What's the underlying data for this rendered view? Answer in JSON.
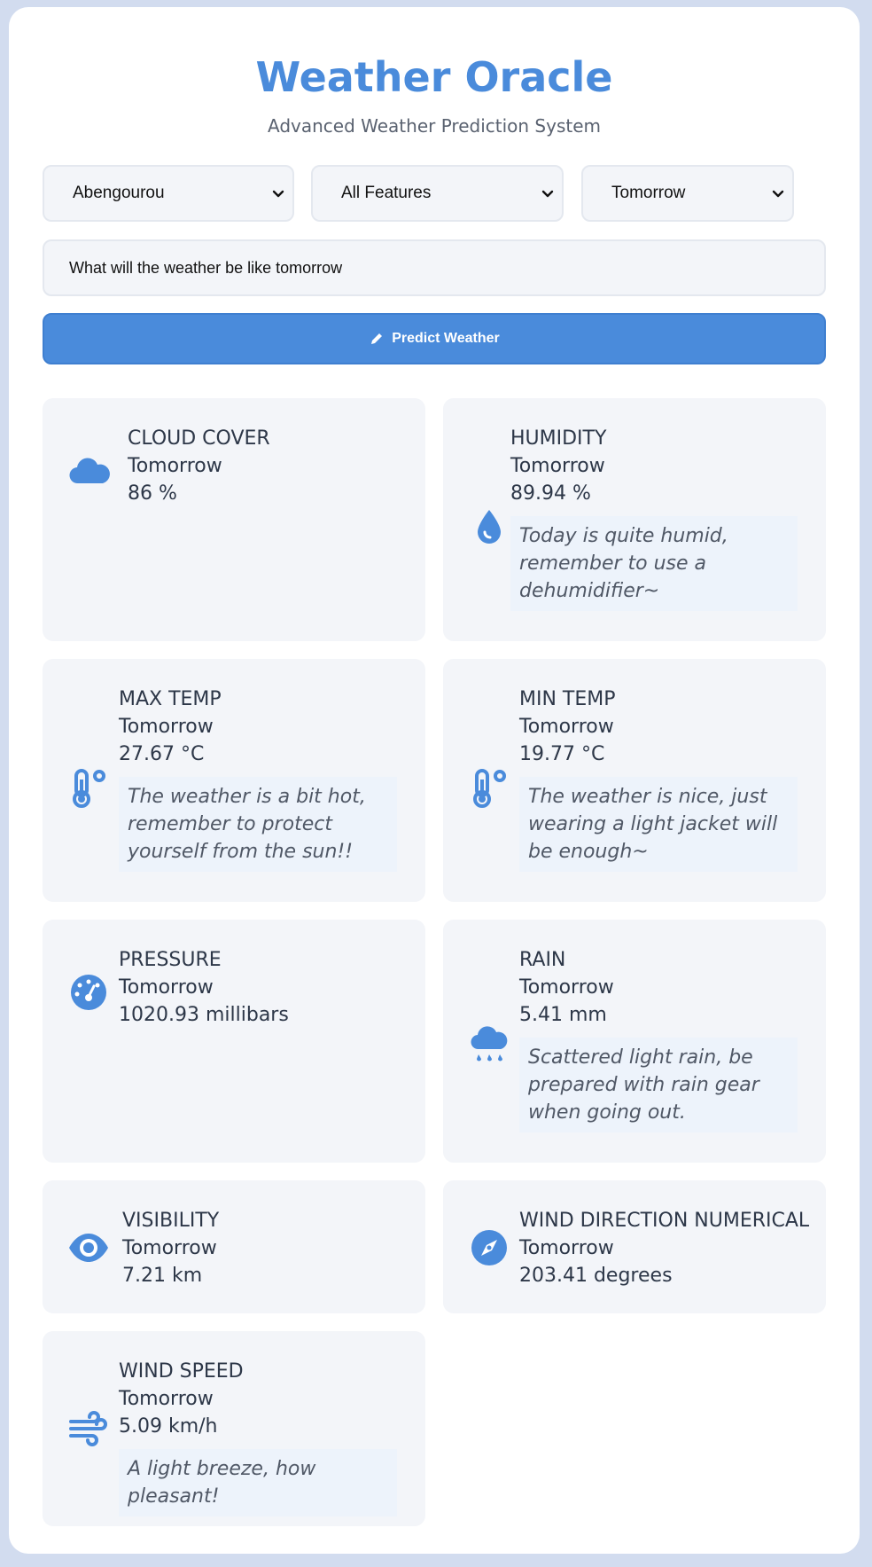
{
  "header": {
    "title": "Weather Oracle",
    "subtitle": "Advanced Weather Prediction System"
  },
  "controls": {
    "location": "Abengourou",
    "feature": "All Features",
    "timeframe": "Tomorrow",
    "query_value": "What will the weather be like tomorrow",
    "predict_label": "Predict Weather"
  },
  "cards": [
    {
      "name": "CLOUD COVER",
      "when": "Tomorrow",
      "value": "86 %",
      "icon": "cloud-icon"
    },
    {
      "name": "HUMIDITY",
      "when": "Tomorrow",
      "value": "89.94 %",
      "tip": "Today is quite humid, remember to use a dehumidifier~",
      "icon": "droplet-icon"
    },
    {
      "name": "MAX TEMP",
      "when": "Tomorrow",
      "value": "27.67 °C",
      "tip": "The weather is a bit hot, remember to protect yourself from the sun!!",
      "icon": "thermometer-icon"
    },
    {
      "name": "MIN TEMP",
      "when": "Tomorrow",
      "value": "19.77 °C",
      "tip": "The weather is nice, just wearing a light jacket will be enough~",
      "icon": "thermometer-icon"
    },
    {
      "name": "PRESSURE",
      "when": "Tomorrow",
      "value": "1020.93 millibars",
      "icon": "gauge-icon"
    },
    {
      "name": "RAIN",
      "when": "Tomorrow",
      "value": "5.41 mm",
      "tip": "Scattered light rain, be prepared with rain gear when going out.",
      "icon": "cloud-rain-icon"
    },
    {
      "name": "VISIBILITY",
      "when": "Tomorrow",
      "value": "7.21 km",
      "icon": "eye-icon"
    },
    {
      "name": "WIND DIRECTION NUMERICAL",
      "when": "Tomorrow",
      "value": "203.41 degrees",
      "icon": "compass-icon"
    },
    {
      "name": "WIND SPEED",
      "when": "Tomorrow",
      "value": "5.09 km/h",
      "tip": "A light breeze, how pleasant!",
      "icon": "wind-icon"
    }
  ],
  "colors": {
    "accent": "#4a8bdb",
    "card_bg": "#f3f5f9",
    "tip_bg": "#edf3fb",
    "page_bg": "#d2dcef"
  }
}
